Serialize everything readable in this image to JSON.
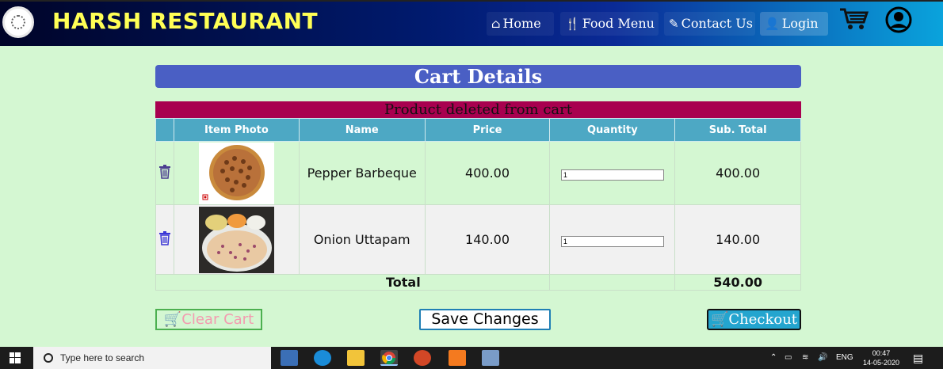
{
  "brand": "HARSH RESTAURANT",
  "nav": {
    "home": "Home",
    "food_menu": "Food Menu",
    "contact": "Contact Us",
    "login": "Login"
  },
  "cart_title": "Cart Details",
  "alert": "Product deleted from cart",
  "table": {
    "headers": [
      "",
      "Item Photo",
      "Name",
      "Price",
      "Quantity",
      "Sub. Total"
    ],
    "rows": [
      {
        "name": "Pepper Barbeque",
        "price": "400.00",
        "quantity": "1",
        "subtotal": "400.00"
      },
      {
        "name": "Onion Uttapam",
        "price": "140.00",
        "quantity": "1",
        "subtotal": "140.00"
      }
    ],
    "total_label": "Total",
    "total_value": "540.00"
  },
  "buttons": {
    "clear_cart": "Clear Cart",
    "save_changes": "Save Changes",
    "checkout": "Checkout"
  },
  "taskbar": {
    "search_placeholder": "Type here to search",
    "lang": "ENG",
    "time": "00:47",
    "date": "14-05-2020"
  },
  "colors": {
    "page_bg": "#d4f7d2",
    "title_bar": "#4a5fc4",
    "alert_bg": "#a8004f",
    "table_header": "#4da8c4",
    "brand_text": "#ffff55"
  }
}
